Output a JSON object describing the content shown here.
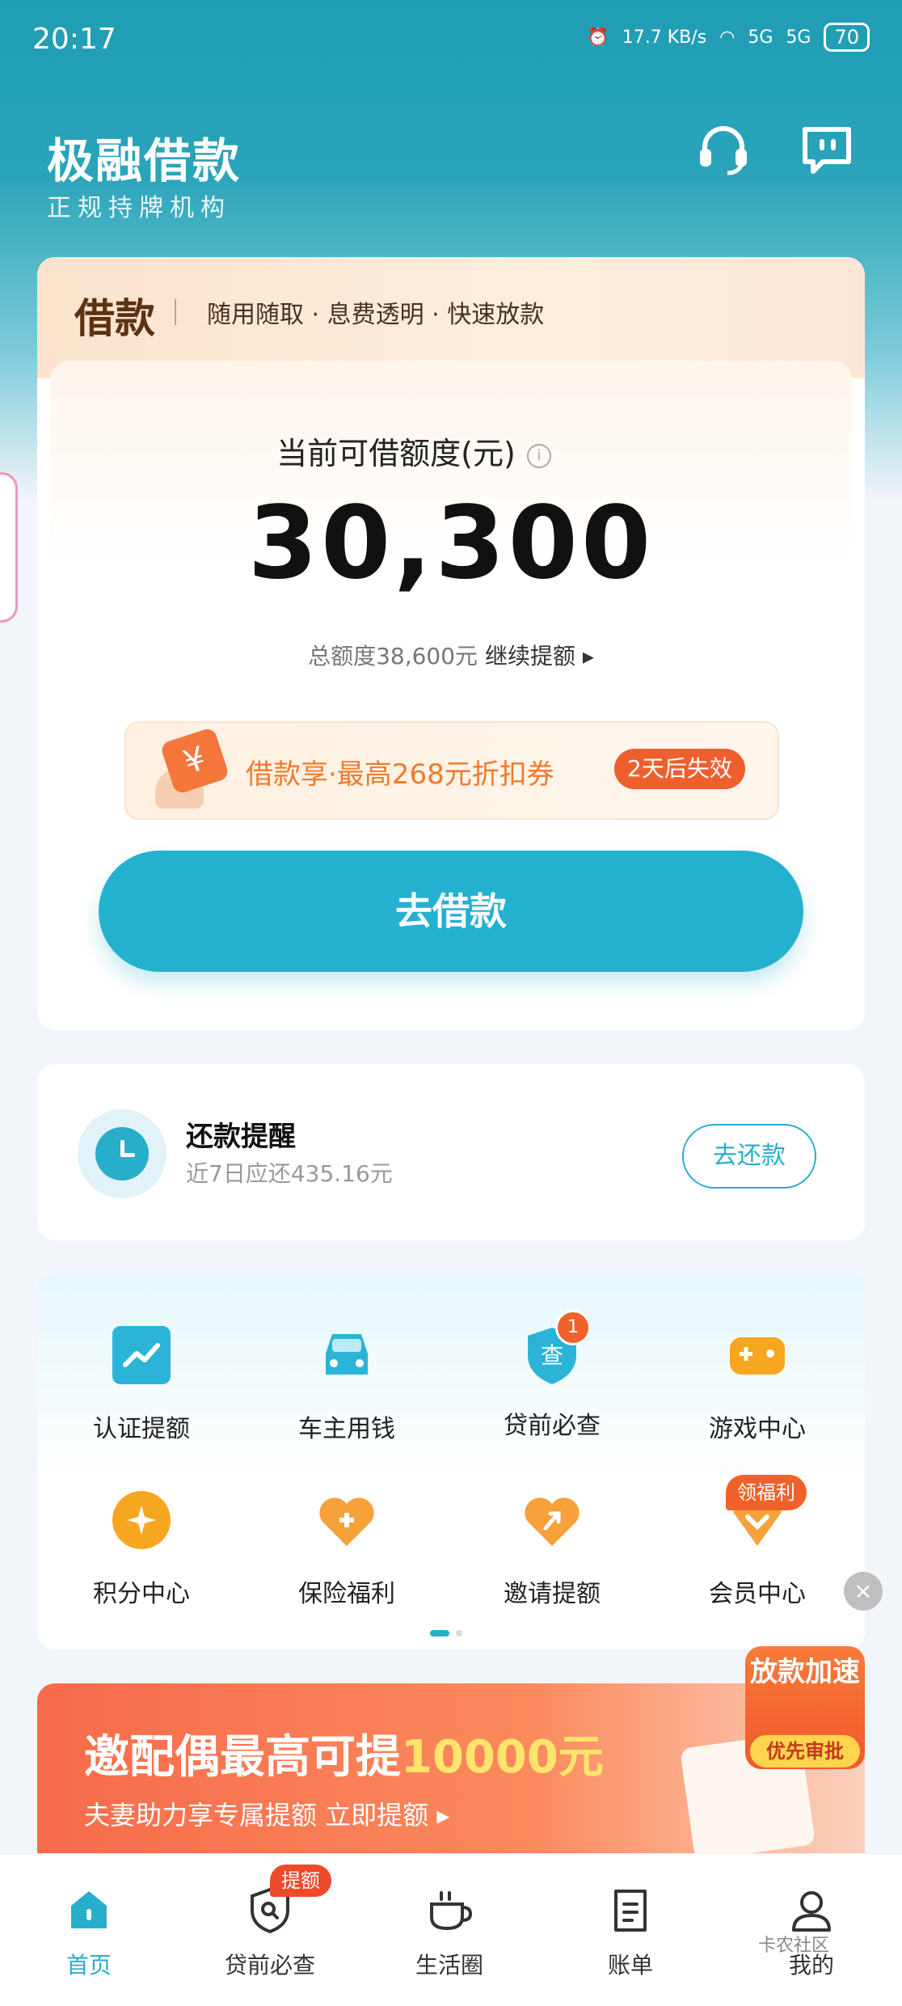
{
  "status_bar": {
    "time": "20:17",
    "net_speed": "17.7 KB/s",
    "signal1": "5G",
    "signal2": "5G",
    "battery": "70"
  },
  "header": {
    "title": "极融借款",
    "subtitle": "正规持牌机构",
    "icons": [
      "headset-icon",
      "message-icon"
    ]
  },
  "loan": {
    "tag": "借款",
    "slogan": "随用随取 · 息费透明 · 快速放款",
    "credit_label": "当前可借额度(元)",
    "credit_amount": "30,300",
    "total_label": "总额度38,600元",
    "raise_link": "继续提额 ▸",
    "coupon_text": "借款享·最高268元折扣券",
    "coupon_badge": "2天后失效",
    "borrow_button": "去借款"
  },
  "repay": {
    "title": "还款提醒",
    "subtitle": "近7日应还435.16元",
    "button": "去还款"
  },
  "services": [
    {
      "label": "认证提额",
      "icon": "chart-up-icon"
    },
    {
      "label": "车主用钱",
      "icon": "car-icon"
    },
    {
      "label": "贷前必查",
      "icon": "shield-check-icon",
      "badge": "1"
    },
    {
      "label": "游戏中心",
      "icon": "gamepad-icon"
    },
    {
      "label": "积分中心",
      "icon": "star-coin-icon"
    },
    {
      "label": "保险福利",
      "icon": "heart-plus-icon"
    },
    {
      "label": "邀请提额",
      "icon": "heart-arrow-icon"
    },
    {
      "label": "会员中心",
      "icon": "vip-icon",
      "badge": "领福利"
    }
  ],
  "banner": {
    "title_prefix": "邀配偶最高可提",
    "title_highlight": "10000元",
    "subtitle": "夫妻助力享专属提额  立即提额 ▸",
    "speed_badge_line": "放款加速",
    "speed_badge_tag": "优先审批"
  },
  "tabbar": {
    "items": [
      "首页",
      "贷前必查",
      "生活圈",
      "账单",
      "我的"
    ],
    "badge": "提额",
    "watermark": "卡农社区"
  },
  "colors": {
    "primary": "#27aecb",
    "orange": "#f1612a",
    "header_bg": "#1f9db3"
  }
}
